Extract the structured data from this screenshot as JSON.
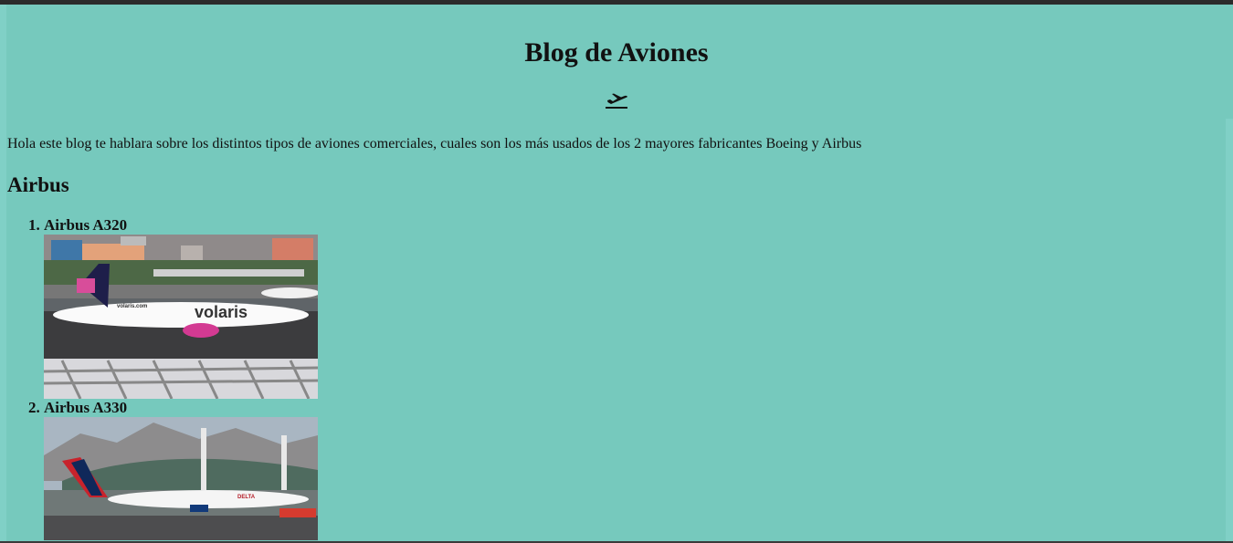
{
  "blog": {
    "title": "Blog de Aviones",
    "icon": "airplane-takeoff-icon",
    "intro": "Hola este blog te hablara sobre los distintos tipos de aviones comerciales, cuales son los más usados de los 2 mayores fabricantes Boeing y Airbus"
  },
  "airbus": {
    "heading": "Airbus",
    "items": [
      {
        "label": "Airbus A320",
        "photo_text": "volaris",
        "photo_small_text": "volaris.com"
      },
      {
        "label": "Airbus A330",
        "photo_text": "DELTA"
      }
    ]
  },
  "colors": {
    "background": "#76c9bd",
    "topbar": "#2b2b2b"
  }
}
